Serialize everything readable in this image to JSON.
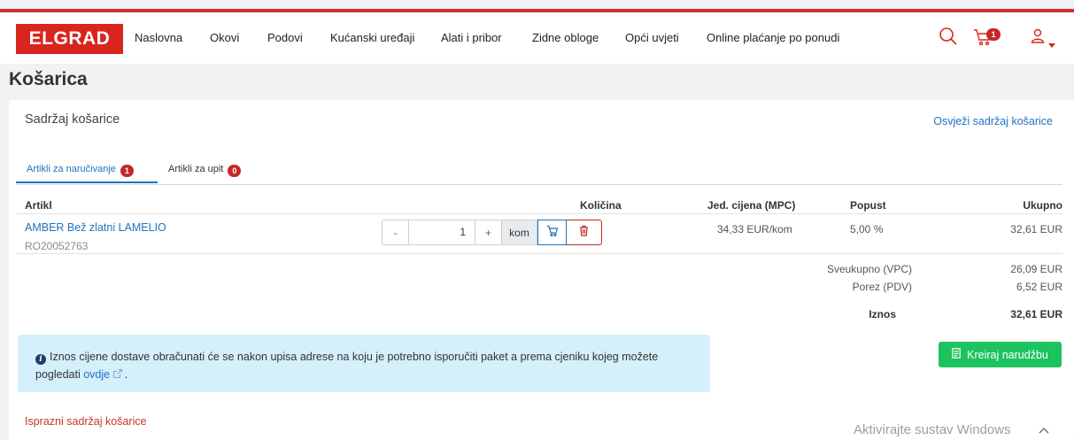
{
  "nav": {
    "logo": "ELGRAD",
    "items": [
      "Naslovna",
      "Okovi",
      "Podovi",
      "Kućanski uređaji",
      "Alati i pribor",
      "Zidne obloge",
      "Opći uvjeti",
      "Online plaćanje po ponudi"
    ],
    "cart_count": "1",
    "icons": [
      "search-icon",
      "cart-icon",
      "user-icon",
      "caret-down-icon"
    ]
  },
  "page": {
    "title": "Košarica"
  },
  "cart": {
    "title": "Sadržaj košarice",
    "refresh": "Osvježi sadržaj košarice",
    "tabs": [
      {
        "label": "Artikli za naručivanje",
        "count": "1"
      },
      {
        "label": "Artikli za upit",
        "count": "0"
      }
    ],
    "columns": {
      "item": "Artikl",
      "qty": "Količina",
      "unit_price": "Jed. cijena (MPC)",
      "discount": "Popust",
      "total": "Ukupno"
    },
    "rows": [
      {
        "name": "AMBER Bež zlatni LAMELIO",
        "code": "RO20052763",
        "qty": "1",
        "unit": "kom",
        "minus": "-",
        "plus": "+",
        "unit_price": "34,33 EUR/kom",
        "discount": "5,00 %",
        "total": "32,61 EUR"
      }
    ],
    "summary": {
      "subtotal_label": "Sveukupno (VPC)",
      "subtotal": "26,09 EUR",
      "tax_label": "Porez (PDV)",
      "tax": "6,52 EUR",
      "amount_label": "Iznos",
      "amount": "32,61 EUR"
    },
    "info": {
      "text": "Iznos cijene dostave obračunati će se nakon upisa adrese na koju je potrebno isporučiti paket a prema cjeniku kojeg možete pogledati",
      "link": "ovdje",
      "end": "."
    },
    "order_button": "Kreiraj narudžbu",
    "empty": "Isprazni sadržaj košarice"
  },
  "system": {
    "watermark": "Aktivirajte sustav Windows"
  },
  "colors": {
    "brand": "#d9251d",
    "link": "#1e73be",
    "success": "#1dc35f",
    "info_bg": "#d4f0fb",
    "badge": "#c62828"
  }
}
